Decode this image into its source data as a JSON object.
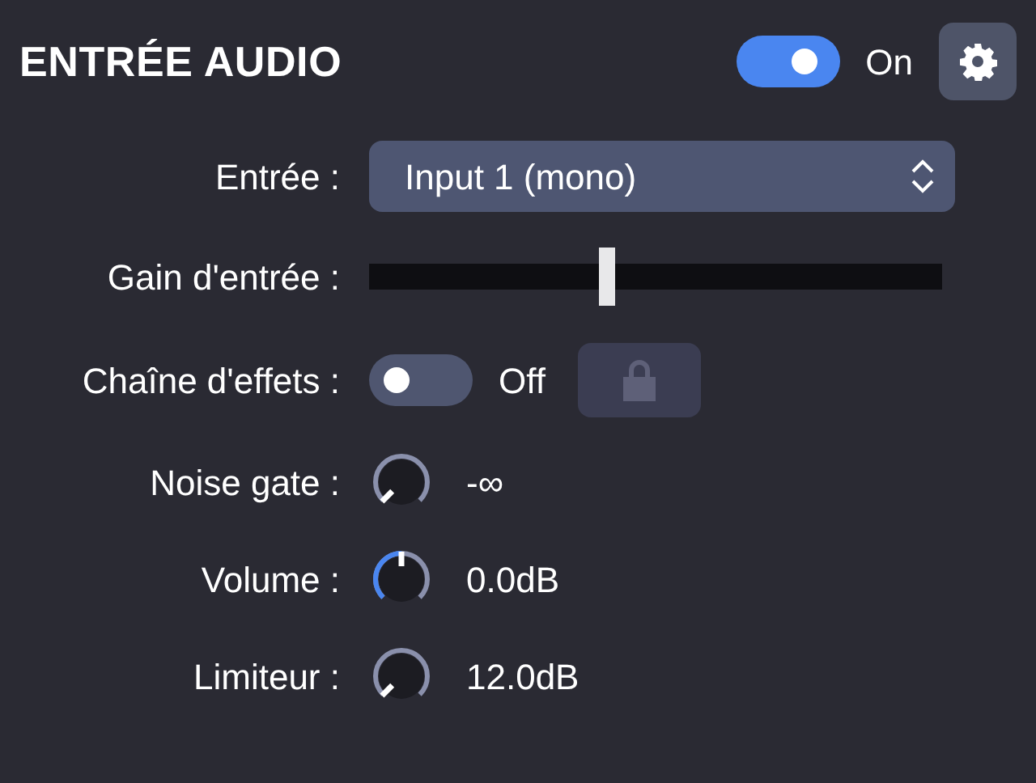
{
  "header": {
    "title": "ENTRÉE AUDIO",
    "toggle": {
      "on": true,
      "label": "On"
    }
  },
  "rows": [
    {
      "kind": "select",
      "label": "Entrée :",
      "value": "Input 1 (mono)"
    },
    {
      "kind": "slider",
      "label": "Gain d'entrée :",
      "level": 0.415
    },
    {
      "kind": "toggle",
      "label": "Chaîne d'effets :",
      "on": false,
      "state_label": "Off",
      "lock_disabled": true
    },
    {
      "kind": "knob",
      "label": "Noise gate :",
      "reading": "-∞"
    },
    {
      "kind": "knob",
      "label": "Volume :",
      "reading": "0.0dB"
    },
    {
      "kind": "knob",
      "label": "Limiteur :",
      "reading": "12.0dB"
    }
  ]
}
